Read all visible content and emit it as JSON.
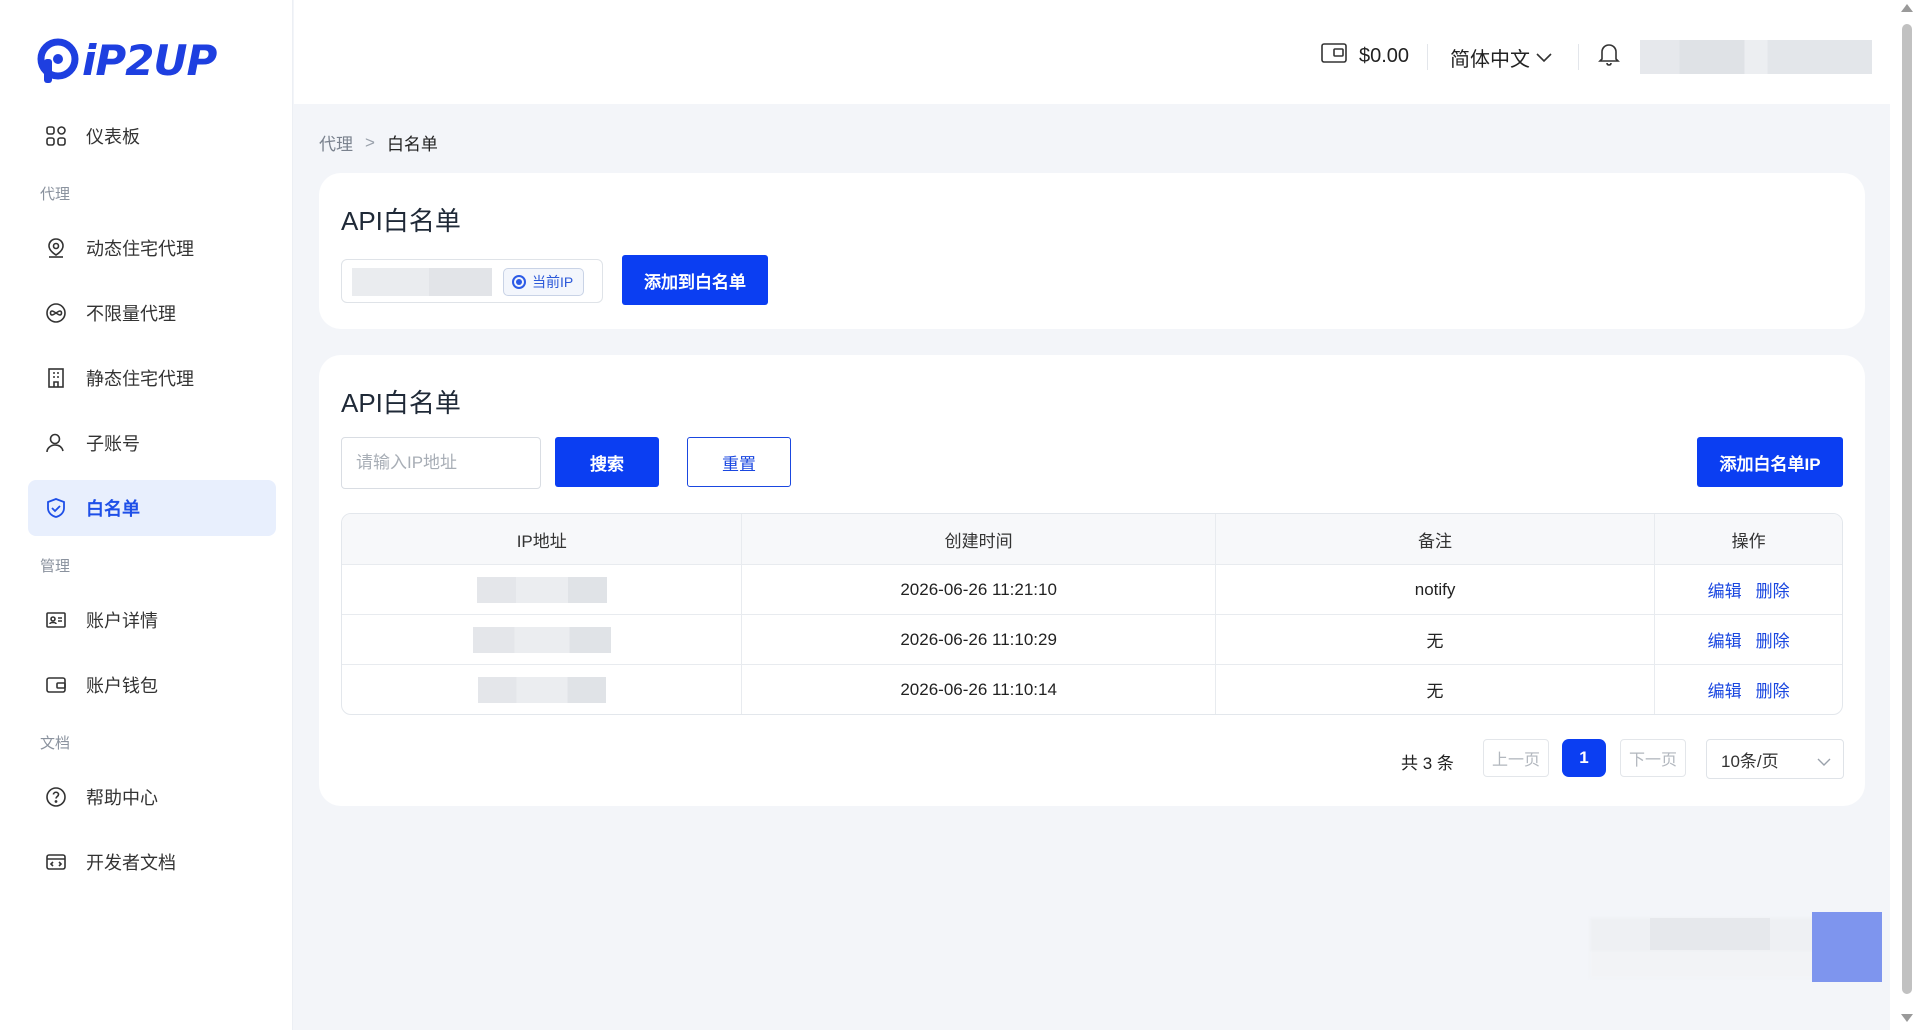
{
  "brand": {
    "name": "iP2UP",
    "color": "#1e3fe0"
  },
  "sidebar": {
    "items": [
      {
        "label": "仪表板",
        "icon": "dashboard-icon",
        "active": false
      },
      {
        "group": "代理"
      },
      {
        "label": "动态住宅代理",
        "icon": "location-icon",
        "active": false
      },
      {
        "label": "不限量代理",
        "icon": "infinity-icon",
        "active": false
      },
      {
        "label": "静态住宅代理",
        "icon": "building-icon",
        "active": false
      },
      {
        "label": "子账号",
        "icon": "user-icon",
        "active": false
      },
      {
        "label": "白名单",
        "icon": "shield-icon",
        "active": true
      },
      {
        "group": "管理"
      },
      {
        "label": "账户详情",
        "icon": "id-card-icon",
        "active": false
      },
      {
        "label": "账户钱包",
        "icon": "wallet-icon",
        "active": false
      },
      {
        "group": "文档"
      },
      {
        "label": "帮助中心",
        "icon": "help-icon",
        "active": false
      },
      {
        "label": "开发者文档",
        "icon": "code-doc-icon",
        "active": false
      }
    ]
  },
  "header": {
    "balance": "$0.00",
    "language": "简体中文"
  },
  "breadcrumb": {
    "parent": "代理",
    "separator": ">",
    "current": "白名单"
  },
  "card1": {
    "title": "API白名单",
    "current_ip_tag": "当前IP",
    "add_button": "添加到白名单"
  },
  "card2": {
    "title": "API白名单",
    "search_placeholder": "请输入IP地址",
    "search_button": "搜索",
    "reset_button": "重置",
    "add_ip_button": "添加白名单IP",
    "columns": [
      "IP地址",
      "创建时间",
      "备注",
      "操作"
    ],
    "rows": [
      {
        "created": "2026-06-26 11:21:10",
        "note": "notify",
        "edit": "编辑",
        "delete": "删除"
      },
      {
        "created": "2026-06-26 11:10:29",
        "note": "无",
        "edit": "编辑",
        "delete": "删除"
      },
      {
        "created": "2026-06-26 11:10:14",
        "note": "无",
        "edit": "编辑",
        "delete": "删除"
      }
    ]
  },
  "pagination": {
    "total": "共 3 条",
    "prev": "上一页",
    "current": "1",
    "next": "下一页",
    "page_size": "10条/页"
  },
  "colors": {
    "primary": "#0b3ef2",
    "active_bg": "#e8effd",
    "page_bg": "#f3f5f9"
  }
}
